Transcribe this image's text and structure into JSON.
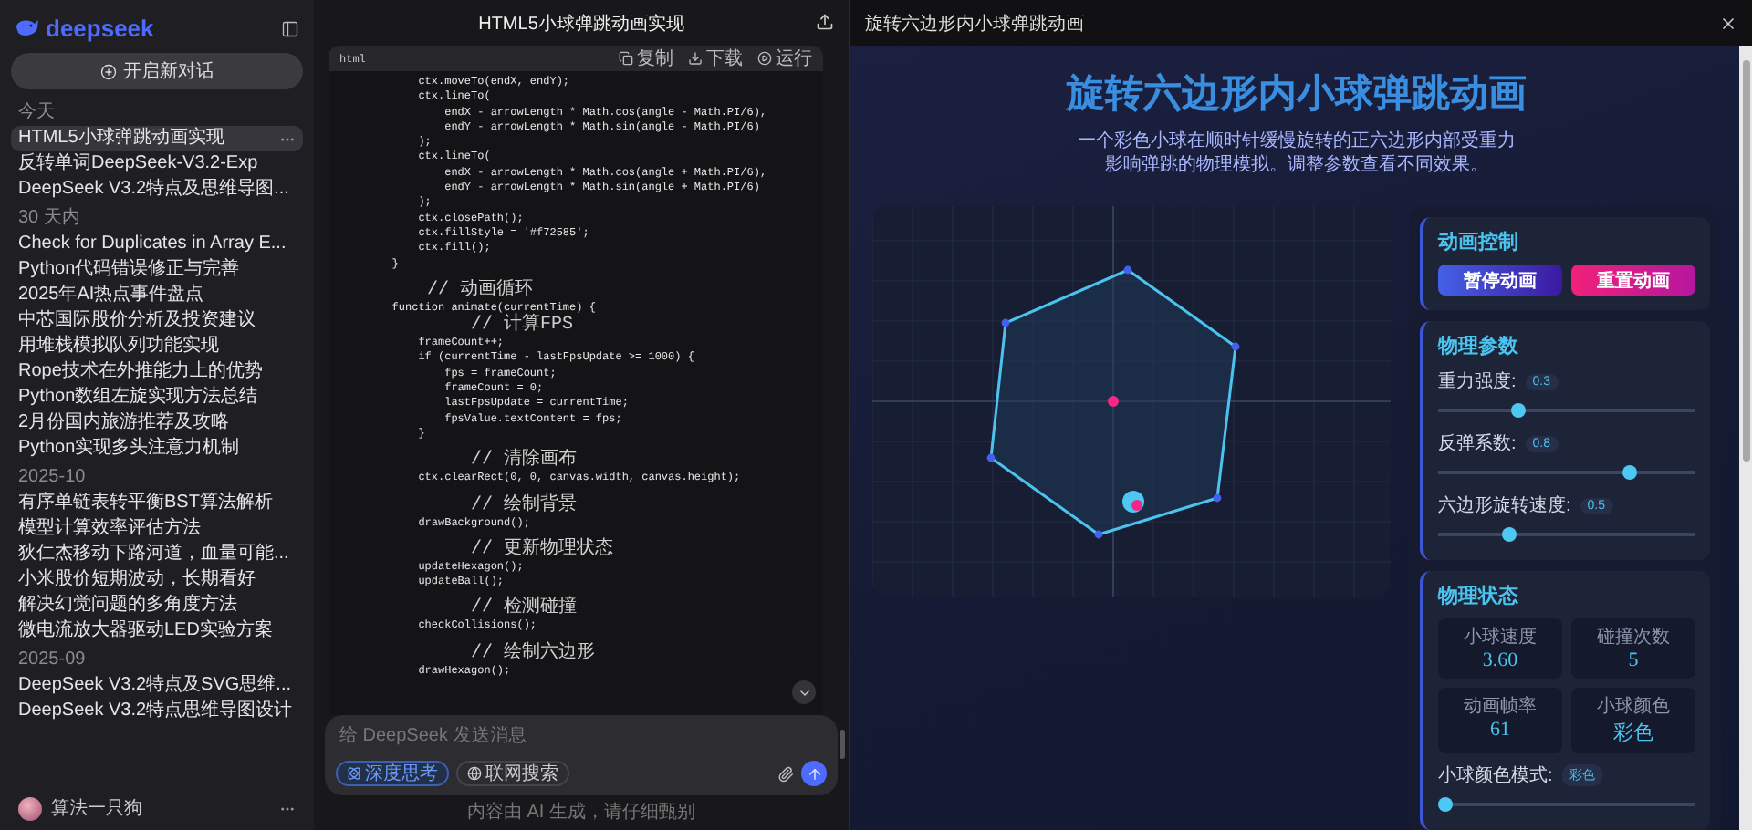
{
  "sidebar": {
    "logo": "deepseek",
    "new_chat": "开启新对话",
    "groups": [
      {
        "label": "今天",
        "items": [
          {
            "title": "HTML5小球弹跳动画实现",
            "selected": true
          },
          {
            "title": "反转单词DeepSeek-V3.2-Exp",
            "selected": false
          },
          {
            "title": "DeepSeek V3.2特点及思维导图...",
            "selected": false
          }
        ]
      },
      {
        "label": "30 天内",
        "items": [
          {
            "title": "Check for Duplicates in Array E...",
            "selected": false
          },
          {
            "title": "Python代码错误修正与完善",
            "selected": false
          },
          {
            "title": "2025年AI热点事件盘点",
            "selected": false
          },
          {
            "title": "中芯国际股价分析及投资建议",
            "selected": false
          },
          {
            "title": "用堆栈模拟队列功能实现",
            "selected": false
          },
          {
            "title": "Rope技术在外推能力上的优势",
            "selected": false
          },
          {
            "title": "Python数组左旋实现方法总结",
            "selected": false
          },
          {
            "title": "2月份国内旅游推荐及攻略",
            "selected": false
          },
          {
            "title": "Python实现多头注意力机制",
            "selected": false
          }
        ]
      },
      {
        "label": "2025-10",
        "items": [
          {
            "title": "有序单链表转平衡BST算法解析",
            "selected": false
          },
          {
            "title": "模型计算效率评估方法",
            "selected": false
          },
          {
            "title": "狄仁杰移动下路河道，血量可能...",
            "selected": false
          },
          {
            "title": "小米股价短期波动，长期看好",
            "selected": false
          },
          {
            "title": "解决幻觉问题的多角度方法",
            "selected": false
          },
          {
            "title": "微电流放大器驱动LED实验方案",
            "selected": false
          }
        ]
      },
      {
        "label": "2025-09",
        "items": [
          {
            "title": "DeepSeek V3.2特点及SVG思维...",
            "selected": false
          },
          {
            "title": "DeepSeek V3.2特点思维导图设计",
            "selected": false
          }
        ]
      }
    ],
    "user": {
      "name": "算法一只狗"
    }
  },
  "chat": {
    "title": "HTML5小球弹跳动画实现",
    "code": {
      "language": "html",
      "actions": [
        "复制",
        "下载",
        "运行"
      ],
      "lines": [
        {
          "kind": "code",
          "text": "            ctx.moveTo(endX, endY);"
        },
        {
          "kind": "code",
          "text": "            ctx.lineTo("
        },
        {
          "kind": "code",
          "text": "                endX - arrowLength * Math.cos(angle - Math.PI/6),"
        },
        {
          "kind": "code",
          "text": "                endY - arrowLength * Math.sin(angle - Math.PI/6)"
        },
        {
          "kind": "code",
          "text": "            );"
        },
        {
          "kind": "code",
          "text": "            ctx.lineTo("
        },
        {
          "kind": "code",
          "text": "                endX - arrowLength * Math.cos(angle + Math.PI/6),"
        },
        {
          "kind": "code",
          "text": "                endY - arrowLength * Math.sin(angle + Math.PI/6)"
        },
        {
          "kind": "code",
          "text": "            );"
        },
        {
          "kind": "code",
          "text": "            ctx.closePath();"
        },
        {
          "kind": "code",
          "text": "            ctx.fillStyle = '#f72585';"
        },
        {
          "kind": "code",
          "text": "            ctx.fill();"
        },
        {
          "kind": "code",
          "text": "        }"
        },
        {
          "kind": "blank"
        },
        {
          "kind": "comment",
          "text": "        // 动画循环"
        },
        {
          "kind": "code",
          "text": "        function animate(currentTime) {"
        },
        {
          "kind": "comment",
          "text": "            // 计算FPS"
        },
        {
          "kind": "code",
          "text": "            frameCount++;"
        },
        {
          "kind": "code",
          "text": "            if (currentTime - lastFpsUpdate >= 1000) {"
        },
        {
          "kind": "code",
          "text": "                fps = frameCount;"
        },
        {
          "kind": "code",
          "text": "                frameCount = 0;"
        },
        {
          "kind": "code",
          "text": "                lastFpsUpdate = currentTime;"
        },
        {
          "kind": "code",
          "text": "                fpsValue.textContent = fps;"
        },
        {
          "kind": "code",
          "text": "            }"
        },
        {
          "kind": "blank"
        },
        {
          "kind": "comment",
          "text": "            // 清除画布"
        },
        {
          "kind": "code",
          "text": "            ctx.clearRect(0, 0, canvas.width, canvas.height);"
        },
        {
          "kind": "blank"
        },
        {
          "kind": "comment",
          "text": "            // 绘制背景"
        },
        {
          "kind": "code",
          "text": "            drawBackground();"
        },
        {
          "kind": "blank"
        },
        {
          "kind": "comment",
          "text": "            // 更新物理状态"
        },
        {
          "kind": "code",
          "text": "            updateHexagon();"
        },
        {
          "kind": "code",
          "text": "            updateBall();"
        },
        {
          "kind": "blank"
        },
        {
          "kind": "comment",
          "text": "            // 检测碰撞"
        },
        {
          "kind": "code",
          "text": "            checkCollisions();"
        },
        {
          "kind": "blank"
        },
        {
          "kind": "comment",
          "text": "            // 绘制六边形"
        },
        {
          "kind": "code",
          "text": "            drawHexagon();"
        }
      ]
    },
    "input": {
      "placeholder": "给 DeepSeek 发送消息",
      "toggles": [
        {
          "label": "深度思考",
          "selected": true
        },
        {
          "label": "联网搜索",
          "selected": false
        }
      ]
    },
    "disclaimer": "内容由 AI 生成，请仔细甄别"
  },
  "preview": {
    "title": "旋转六边形内小球弹跳动画",
    "heading": "旋转六边形内小球弹跳动画",
    "subtitle": "一个彩色小球在顺时针缓慢旋转的正六边形内部受重力影响弹跳的物理模拟。调整参数查看不同效果。",
    "controls": {
      "title": "动画控制",
      "buttons": [
        {
          "label": "暂停动画",
          "kind": "primary"
        },
        {
          "label": "重置动画",
          "kind": "danger"
        }
      ]
    },
    "params": {
      "title": "物理参数",
      "sliders": [
        {
          "label": "重力强度:",
          "reading": "0.3",
          "level": 0.3
        },
        {
          "label": "反弹系数:",
          "reading": "0.8",
          "level": 0.76
        },
        {
          "label": "六边形旋转速度:",
          "reading": "0.5",
          "level": 0.26
        }
      ]
    },
    "status": {
      "title": "物理状态",
      "stats": [
        {
          "label": "小球速度",
          "value": "3.60"
        },
        {
          "label": "碰撞次数",
          "value": "5"
        },
        {
          "label": "动画帧率",
          "value": "61"
        },
        {
          "label": "小球颜色",
          "value": "彩色"
        }
      ],
      "color_mode": {
        "label": "小球颜色模式:",
        "reading": "彩色",
        "level": 0
      }
    }
  }
}
